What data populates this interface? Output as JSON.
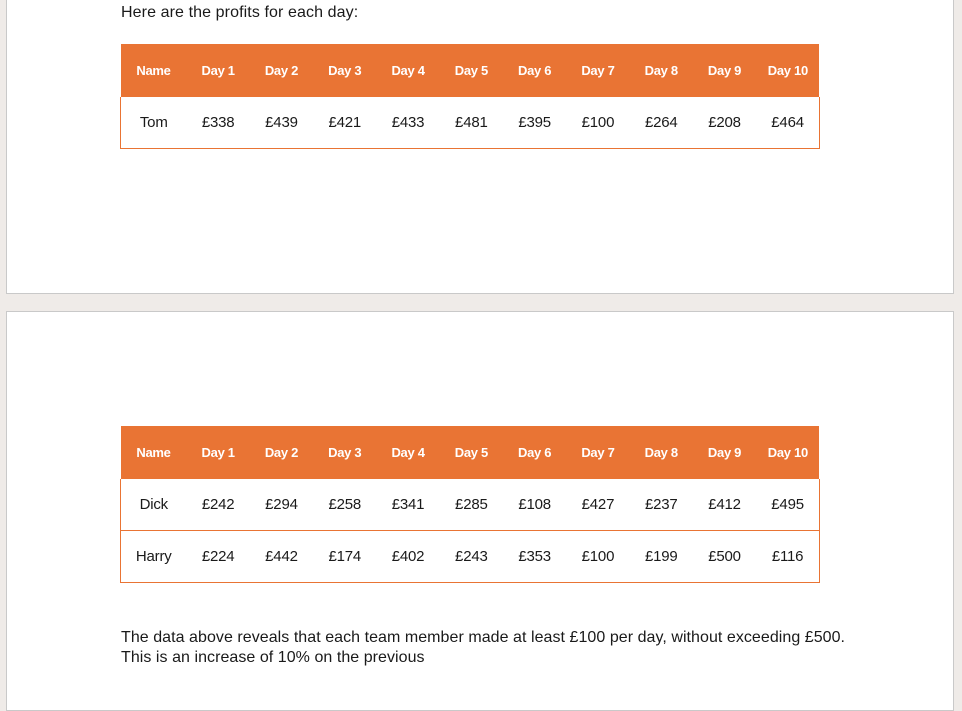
{
  "document": {
    "intro_text": "Here are the profits for each day:",
    "table_headers": [
      "Name",
      "Day 1",
      "Day 2",
      "Day 3",
      "Day 4",
      "Day 5",
      "Day 6",
      "Day 7",
      "Day 8",
      "Day 9",
      "Day 10"
    ],
    "table1": {
      "rows": [
        {
          "name": "Tom",
          "values": [
            "£338",
            "£439",
            "£421",
            "£433",
            "£481",
            "£395",
            "£100",
            "£264",
            "£208",
            "£464"
          ]
        }
      ]
    },
    "table2": {
      "rows": [
        {
          "name": "Dick",
          "values": [
            "£242",
            "£294",
            "£258",
            "£341",
            "£285",
            "£108",
            "£427",
            "£237",
            "£412",
            "£495"
          ]
        },
        {
          "name": "Harry",
          "values": [
            "£224",
            "£442",
            "£174",
            "£402",
            "£243",
            "£353",
            "£100",
            "£199",
            "£500",
            "£116"
          ]
        }
      ]
    },
    "conclusion_text": "The data above reveals that each team member made at least £100 per day, without exceeding £500. This is an increase of 10% on the previous"
  },
  "colors": {
    "header_bg": "#e97434",
    "header_text": "#ffffff",
    "border": "#e97434"
  }
}
